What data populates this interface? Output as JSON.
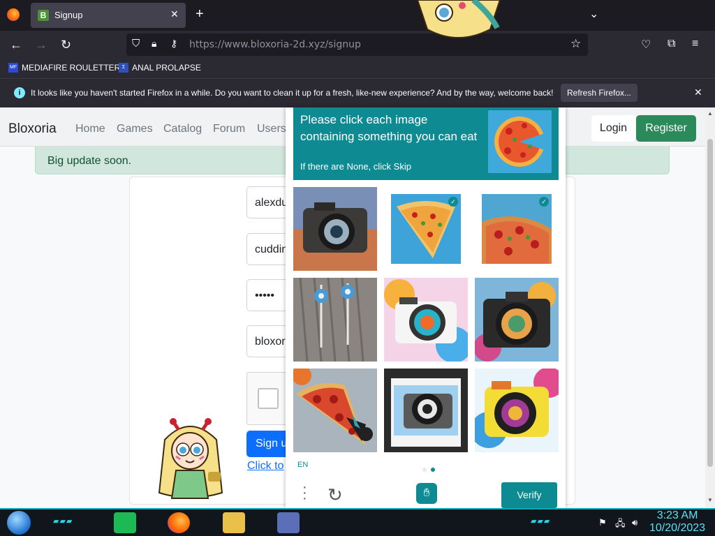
{
  "browser": {
    "tab_title": "Signup",
    "tab_favicon_letter": "B",
    "url": "https://www.bloxoria-2d.xyz/signup",
    "bookmarks": [
      {
        "label": "MEDIAFIRE ROULETTER"
      },
      {
        "label": "ANAL PROLAPSE"
      }
    ],
    "notification": {
      "message": "It looks like you haven't started Firefox in a while. Do you want to clean it up for a fresh, like-new experience? And by the way, welcome back!",
      "button_label": "Refresh Firefox..."
    }
  },
  "site": {
    "brand": "Bloxoria",
    "nav": [
      "Home",
      "Games",
      "Catalog",
      "Forum",
      "Users"
    ],
    "login_label": "Login",
    "register_label": "Register",
    "alert": "Big update soon.",
    "form": {
      "field_values": [
        "alexdu",
        "cuddin",
        "•••••",
        "bloxor"
      ],
      "signup_label": "Sign u",
      "link_text": "Click to"
    }
  },
  "captcha": {
    "prompt": "Please click each image containing something you can eat",
    "subprompt": "If there are None, click Skip",
    "tiles": [
      {
        "name": "camera",
        "selected": false
      },
      {
        "name": "pizza-slice",
        "selected": true
      },
      {
        "name": "pizza",
        "selected": true
      },
      {
        "name": "earbuds",
        "selected": false
      },
      {
        "name": "camera-colorful",
        "selected": false
      },
      {
        "name": "camera-painted",
        "selected": false
      },
      {
        "name": "pizza-slice-plate",
        "selected": false
      },
      {
        "name": "camera-polaroid",
        "selected": false
      },
      {
        "name": "camera-yellow",
        "selected": false
      }
    ],
    "language": "EN",
    "verify_label": "Verify",
    "accent": "#0e8a92"
  },
  "taskbar": {
    "time": "3:23 AM",
    "date": "10/20/2023"
  }
}
